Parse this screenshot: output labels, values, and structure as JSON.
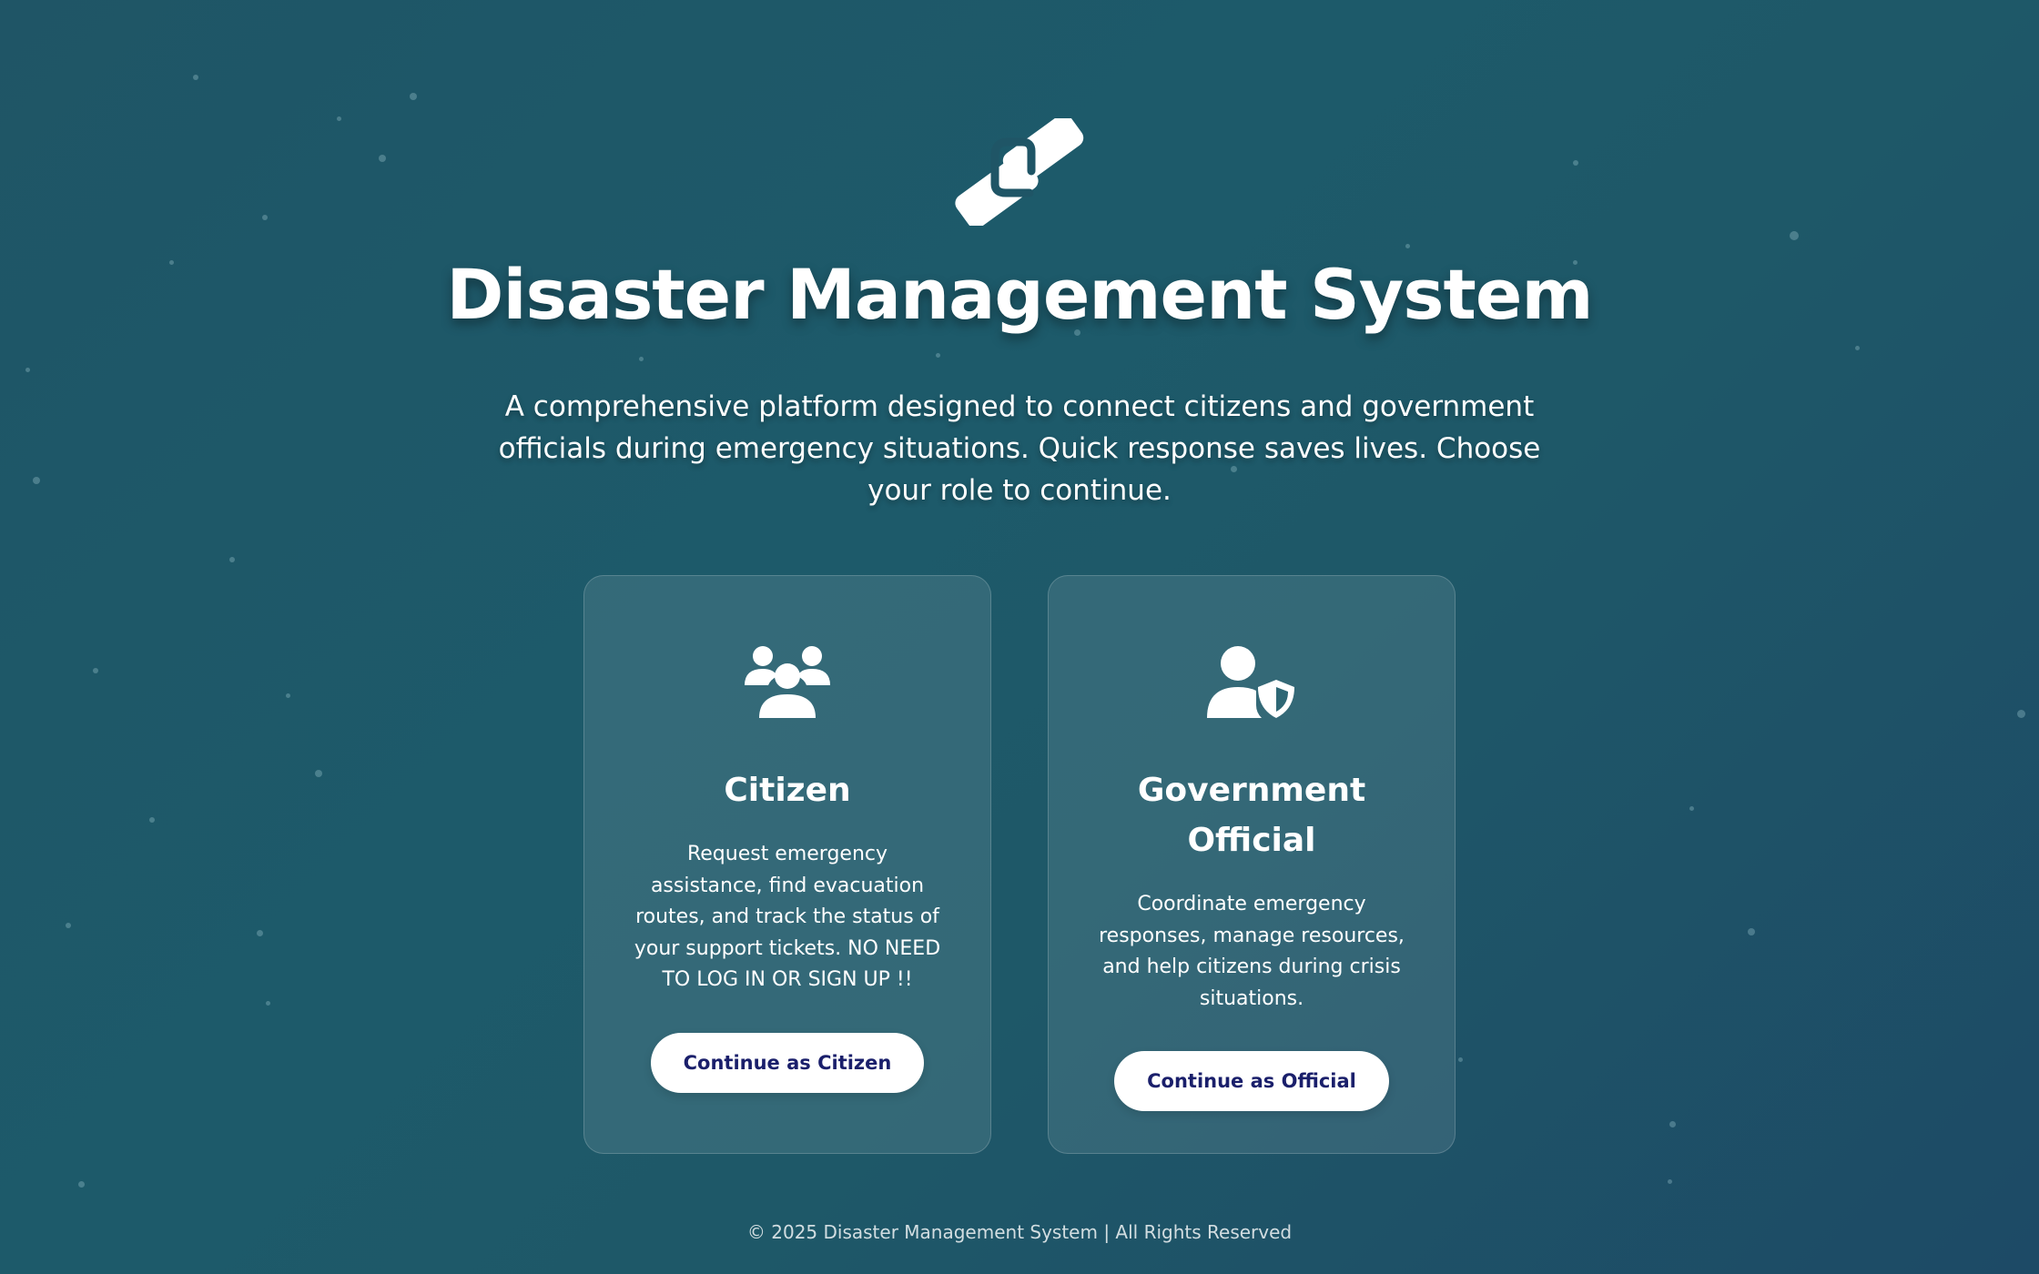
{
  "header": {
    "logo_icon": "handshake-icon",
    "title": "Disaster Management System",
    "subtitle": "A comprehensive platform designed to connect citizens and government officials during emergency situations. Quick response saves lives. Choose your role to continue."
  },
  "cards": [
    {
      "icon": "users-group-icon",
      "title": "Citizen",
      "description": "Request emergency assistance, find evacuation routes, and track the status of your support tickets. NO NEED TO LOG IN OR SIGN UP !!",
      "button_label": "Continue as Citizen"
    },
    {
      "icon": "user-shield-icon",
      "title": "Government Official",
      "description": "Coordinate emergency responses, manage resources, and help citizens during crisis situations.",
      "button_label": "Continue as Official"
    }
  ],
  "footer": {
    "text": "© 2025 Disaster Management System | All Rights Reserved"
  },
  "colors": {
    "background": "#1f5566",
    "button_text": "#1a1f6b",
    "button_bg": "#ffffff"
  }
}
